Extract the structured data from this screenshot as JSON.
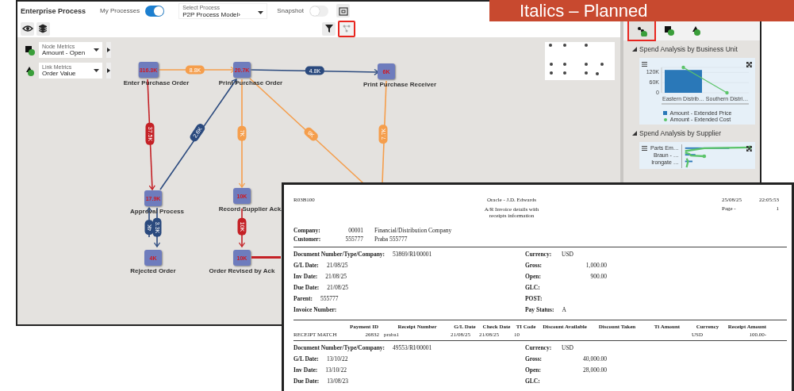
{
  "banner": "Italics – Planned",
  "app": {
    "title": "Enterprise Process",
    "my_processes": {
      "label": "My Processes",
      "on": true
    },
    "select_process": {
      "label": "Select Process",
      "value": "P2P Process Model›"
    },
    "snapshot": {
      "label": "Snapshot",
      "on": false
    },
    "toolbar_right": [
      {
        "kind": "filter",
        "highlighted": false
      },
      {
        "kind": "graph",
        "highlighted": true
      }
    ]
  },
  "metrics": [
    {
      "kind": "node",
      "label": "Node Metrics",
      "value": "Amount - Open"
    },
    {
      "kind": "link",
      "label": "Link Metrics",
      "value": "Order Value"
    }
  ],
  "graph": {
    "nodes": [
      {
        "label": "Enter Purchase Order",
        "value": "316.3K"
      },
      {
        "label": "Print Purchase Order",
        "value": "20.7K"
      },
      {
        "label": "Print Purchase Receiver",
        "value": "6K"
      },
      {
        "label": "Approval Process",
        "value": "17.9K"
      },
      {
        "label": "Record Supplier Ack.",
        "value": "10K"
      },
      {
        "label": "Rejected Order",
        "value": "4K"
      },
      {
        "label": "Order Revised by Ack",
        "value": "10K"
      }
    ],
    "edges": [
      {
        "label": "8.8K",
        "color": "#f59e4c"
      },
      {
        "label": "4.8K",
        "color": "#2b4a7e"
      },
      {
        "label": "37.5K",
        "color": "#c42126"
      },
      {
        "label": "2.6K",
        "color": "#2b4a7e"
      },
      {
        "label": "7K",
        "color": "#f59e4c"
      },
      {
        "label": "9K",
        "color": "#f59e4c"
      },
      {
        "label": "7.7K",
        "color": "#f59e4c"
      },
      {
        "label": "4K",
        "color": "#2b4a7e"
      },
      {
        "label": "3.3K",
        "color": "#2b4a7e"
      },
      {
        "label": "10K",
        "color": "#c42126"
      },
      {
        "color": "#c42126"
      }
    ]
  },
  "side_panel": {
    "tabs": [
      {
        "kind": "graph",
        "selected": true,
        "highlighted": true
      },
      {
        "kind": "node",
        "selected": false,
        "highlighted": false
      },
      {
        "kind": "link",
        "selected": false,
        "highlighted": false
      }
    ],
    "sections": [
      {
        "title": "Spend Analysis by Business Unit",
        "expanded": true,
        "chart_data": {
          "type": "bar",
          "categories": [
            "Eastern Distrib…",
            "Southern Distri…"
          ],
          "yticks": [
            {
              "value": 0,
              "label": "0"
            },
            {
              "value": 60000,
              "label": "60K"
            },
            {
              "value": 120000,
              "label": "120K"
            }
          ],
          "ylim": [
            0,
            150000
          ],
          "series": [
            {
              "name": "Amount - Extended Price",
              "color": "#2a78b8",
              "values": [
                135000,
                null
              ]
            },
            {
              "name": "Amount - Extended Cost",
              "color": "#5cc46a",
              "type": "line",
              "values": [
                150000,
                0
              ]
            }
          ]
        }
      },
      {
        "title": "Spend Analysis by Supplier",
        "expanded": true,
        "categories": [
          "Parts Em…",
          "Braun - …",
          "Irongate …"
        ]
      }
    ]
  },
  "report": {
    "program": "R03B100",
    "company_name": "Oracle - J.D. Edwards",
    "title_lines": [
      "A/R Invoice details with",
      "receipts information"
    ],
    "date": "25/08/25",
    "time": "22:05:53",
    "page_label": "Page -",
    "page": "1",
    "heads": [
      {
        "label": "Company:",
        "values": [
          "00001",
          "Financial/Distribution Company"
        ]
      },
      {
        "label": "Customer:",
        "values": [
          "555777",
          "Praba 555777"
        ]
      }
    ],
    "documents": [
      {
        "left": [
          {
            "label": "Document Number/Type/Company:",
            "value": "53869/RI/00001"
          },
          {
            "label": "G/L Date:",
            "value": "21/08/25"
          },
          {
            "label": "Inv Date:",
            "value": "21/08/25"
          },
          {
            "label": "Due Date:",
            "value": "21/08/25"
          },
          {
            "label": "Parent:",
            "value": "555777"
          },
          {
            "label": "Invoice Number:"
          }
        ],
        "right": [
          {
            "label": "Currency:",
            "value": "USD"
          },
          {
            "label": "Gross:",
            "value": "1,000.00",
            "kind": "amount"
          },
          {
            "label": "Open:",
            "value": "900.00",
            "kind": "amount"
          },
          {
            "label": "GLC:"
          },
          {
            "label": "POST:"
          },
          {
            "label": "Pay Status:",
            "value": "A"
          }
        ],
        "receipts": {
          "columns": [
            "Payment ID",
            "Receipt Number",
            "G/L Date",
            "Check Date",
            "TI Code",
            "Discount Available",
            "Discount Taken",
            "Ti Amount",
            "Currency",
            "Receipt Amount"
          ],
          "rows": [
            {
              "label": "RECEIPT MATCH",
              "cells": [
                "26832",
                "praba1",
                "21/08/25",
                "21/08/25",
                "10",
                null,
                null,
                null,
                "USD",
                "100.00-"
              ]
            }
          ]
        }
      },
      {
        "left": [
          {
            "label": "Document Number/Type/Company:",
            "value": "49553/RI/00001"
          },
          {
            "label": "G/L Date:",
            "value": "13/10/22"
          },
          {
            "label": "Inv Date:",
            "value": "13/10/22"
          },
          {
            "label": "Due Date:",
            "value": "13/08/23"
          }
        ],
        "right": [
          {
            "label": "Currency:",
            "value": "USD"
          },
          {
            "label": "Gross:",
            "value": "40,000.00",
            "kind": "amount"
          },
          {
            "label": "Open:",
            "value": "28,000.00",
            "kind": "amount"
          },
          {
            "label": "GLC:"
          }
        ]
      }
    ]
  }
}
